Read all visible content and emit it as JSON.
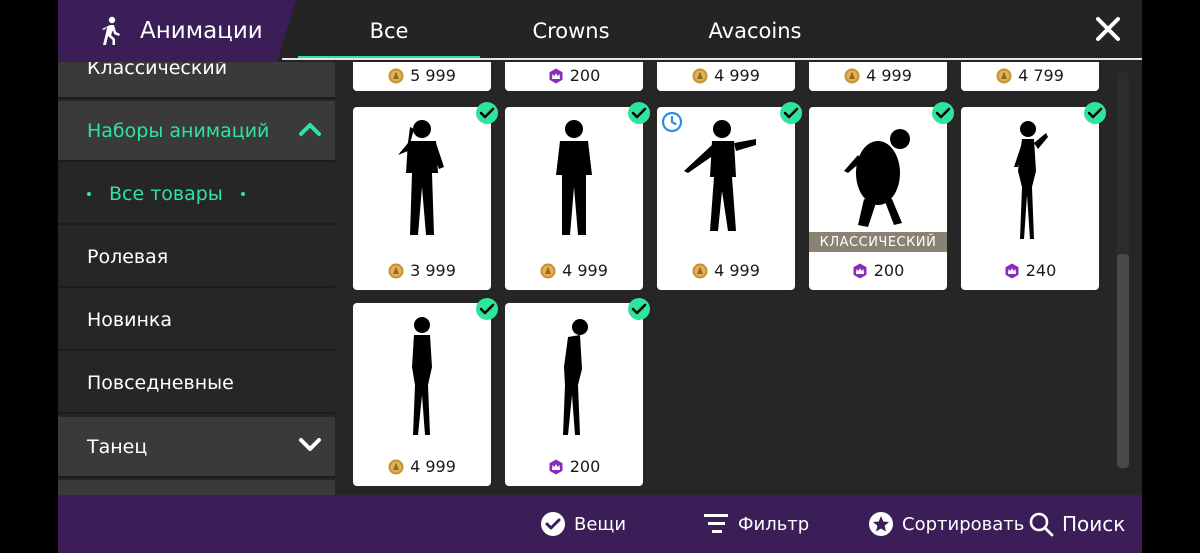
{
  "header": {
    "title": "Анимации",
    "tabs": [
      {
        "label": "Все",
        "active": true
      },
      {
        "label": "Crowns",
        "active": false
      },
      {
        "label": "Avacoins",
        "active": false
      }
    ]
  },
  "sidebar": {
    "items": [
      {
        "label": "Классический"
      },
      {
        "label": "Наборы анимаций"
      },
      {
        "label": "Все товары"
      },
      {
        "label": "Ролевая"
      },
      {
        "label": "Новинка"
      },
      {
        "label": "Повседневные"
      },
      {
        "label": "Танец"
      }
    ]
  },
  "top_row_prices": [
    {
      "currency": "avacoins",
      "price": "5 999"
    },
    {
      "currency": "crowns",
      "price": "200"
    },
    {
      "currency": "avacoins",
      "price": "4 999"
    },
    {
      "currency": "avacoins",
      "price": "4 999"
    },
    {
      "currency": "avacoins",
      "price": "4 799"
    }
  ],
  "cards": [
    {
      "currency": "avacoins",
      "price": "3 999",
      "owned": true
    },
    {
      "currency": "avacoins",
      "price": "4 999",
      "owned": true
    },
    {
      "currency": "avacoins",
      "price": "4 999",
      "owned": true,
      "timed": true
    },
    {
      "currency": "crowns",
      "price": "200",
      "owned": true,
      "badge": "КЛАССИЧЕСКИЙ"
    },
    {
      "currency": "crowns",
      "price": "240",
      "owned": true
    },
    {
      "currency": "avacoins",
      "price": "4 999",
      "owned": true
    },
    {
      "currency": "crowns",
      "price": "200",
      "owned": true
    }
  ],
  "bottom_bar": {
    "items": [
      {
        "label": "Вещи",
        "icon": "check-circle-icon"
      },
      {
        "label": "Фильтр",
        "icon": "filter-icon"
      },
      {
        "label": "Сортировать",
        "icon": "star-badge-icon"
      },
      {
        "label": "Поиск",
        "icon": "search-icon"
      }
    ]
  },
  "colors": {
    "accent": "#2ee59d",
    "brand_purple": "#3b1d58",
    "background": "#262626",
    "coin_gold": "#c8902e",
    "crown_purple": "#8a2bb8"
  }
}
